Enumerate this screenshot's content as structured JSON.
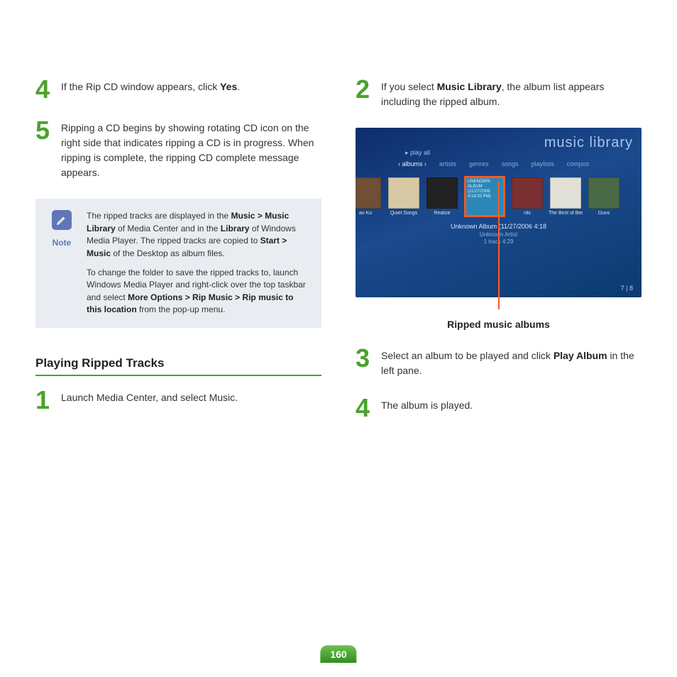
{
  "left": {
    "step4": {
      "num": "4",
      "text_a": "If the Rip CD window appears, click ",
      "bold": "Yes",
      "text_b": "."
    },
    "step5": {
      "num": "5",
      "text": "Ripping a CD begins by showing rotating CD icon on the right side that indicates ripping a CD is in progress. When ripping is complete, the ripping CD complete message appears."
    },
    "note": {
      "label": "Note",
      "p1_a": "The ripped tracks are displayed in the ",
      "p1_b1": "Music > Music Library",
      "p1_c": " of Media Center and in the ",
      "p1_b2": "Library",
      "p1_d": " of Windows Media Player. The ripped tracks are copied to ",
      "p1_b3": "Start > Music",
      "p1_e": " of the Desktop as album files.",
      "p2_a": "To change the folder to save the ripped tracks to, launch Windows Media Player and right-click over the top taskbar and select ",
      "p2_b": "More Options > Rip Music > Rip music to this location",
      "p2_c": " from the pop-up menu."
    },
    "section_title": "Playing Ripped Tracks",
    "step1": {
      "num": "1",
      "text": "Launch Media Center, and select Music."
    }
  },
  "right": {
    "step2": {
      "num": "2",
      "text_a": "If you select ",
      "bold": "Music Library",
      "text_b": ", the album list appears including the ripped album."
    },
    "screenshot": {
      "title": "music library",
      "menu": "▸  play all",
      "tabs": {
        "t0": "‹ albums ›",
        "t1": "artists",
        "t2": "genres",
        "t3": "songs",
        "t4": "playlists",
        "t5": "compos"
      },
      "albums": {
        "a0": "ao Ko",
        "a1": "Quiet Songs",
        "a2": "Realize",
        "hl_text": "UNKNOWN ALBUM (11/27/2006 4:18:33 PM)",
        "a4": "rds",
        "a5": "The Best of Beethoven",
        "a6": "Duos"
      },
      "selected": {
        "line1": "Unknown Album (11/27/2006 4:18",
        "line2": "Unknown Artist",
        "line3": "1 track   4:29"
      },
      "counter": "7 | 8"
    },
    "figure_caption": "Ripped music albums",
    "step3": {
      "num": "3",
      "text_a": "Select an album to be played and click ",
      "bold": "Play Album",
      "text_b": " in the left pane."
    },
    "step4": {
      "num": "4",
      "text": "The album is played."
    }
  },
  "page_number": "160"
}
